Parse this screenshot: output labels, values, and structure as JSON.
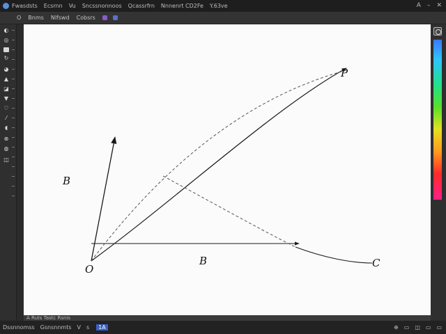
{
  "titlebar": {
    "menu": [
      "Fwasdsts",
      "Ecsrnn",
      "Vu",
      "Sncssnonnoos",
      "Qcassrfrn",
      "Nnnenrt CD2Fe",
      "Y.63ve"
    ],
    "icons": {
      "app": "app-logo-icon",
      "share": "share-icon",
      "minimize": "minimize-icon",
      "close": "close-icon"
    },
    "win_labels": {
      "share": "A",
      "minimize": "–",
      "close": "✕"
    }
  },
  "optionsbar": {
    "items": [
      "O",
      "Bnms",
      "Nlfswd",
      "Cobsrs"
    ]
  },
  "canvas": {
    "labels": {
      "origin": "O",
      "left_b": "B",
      "bottom_b": "B",
      "c": "C",
      "top": "P"
    }
  },
  "layerbar": {
    "text": "A Ruts Tastc Rsnis"
  },
  "statusbar": {
    "items": [
      "Dssnnomss",
      "Gsnsnnmts",
      "V",
      "s"
    ],
    "zoom": "1A",
    "right_icons": [
      "⊕",
      "▭",
      "◫",
      "▭",
      "▭"
    ]
  },
  "colors": {
    "canvas_bg": "#fbfbfb",
    "ink": "#1a1a1a",
    "accent": "#3a5fc0"
  }
}
